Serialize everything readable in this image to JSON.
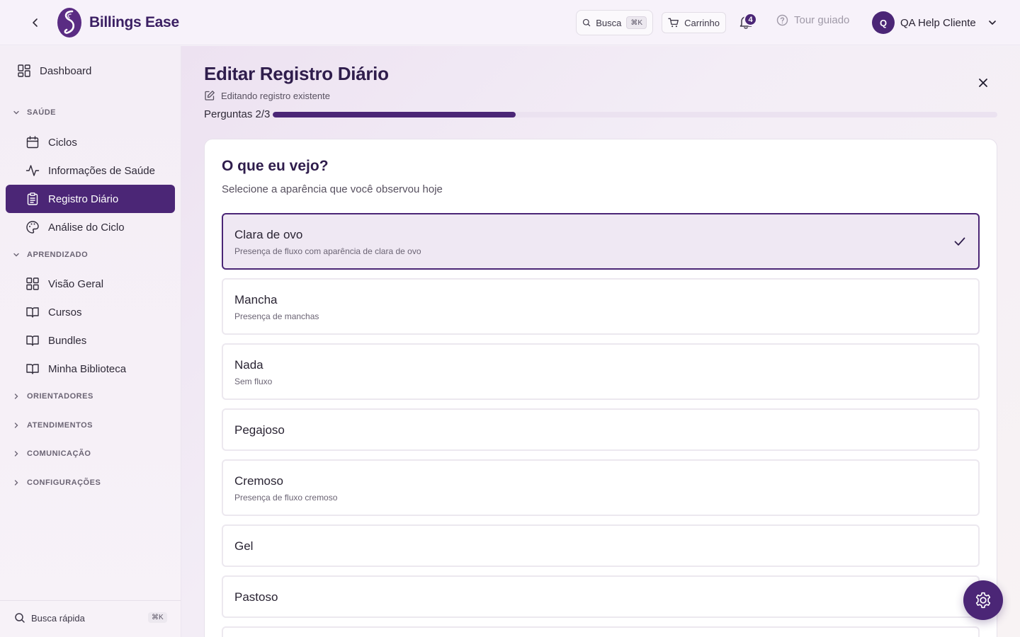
{
  "header": {
    "brand": "Billings Ease",
    "search_label": "Busca",
    "search_shortcut": "⌘K",
    "cart_label": "Carrinho",
    "notification_count": "4",
    "tour_label": "Tour guiado",
    "user_initial": "Q",
    "user_name": "QA Help Cliente"
  },
  "sidebar": {
    "dashboard": "Dashboard",
    "sections": {
      "saude": "SAÚDE",
      "aprendizado": "APRENDIZADO",
      "orientadores": "ORIENTADORES",
      "atendimentos": "ATENDIMENTOS",
      "comunicacao": "COMUNICAÇÃO",
      "configuracoes": "CONFIGURAÇÕES"
    },
    "saude_items": [
      "Ciclos",
      "Informações de Saúde",
      "Registro Diário",
      "Análise do Ciclo"
    ],
    "aprendizado_items": [
      "Visão Geral",
      "Cursos",
      "Bundles",
      "Minha Biblioteca"
    ],
    "quick_search": "Busca rápida",
    "quick_search_shortcut": "⌘K"
  },
  "main": {
    "title": "Editar Registro Diário",
    "edit_note": "Editando registro existente",
    "progress_label": "Perguntas 2/3",
    "progress_fraction": 0.3353,
    "question": {
      "title": "O que eu vejo?",
      "subtitle": "Selecione a aparência que você observou hoje",
      "options": [
        {
          "label": "Clara de ovo",
          "desc": "Presença de fluxo com aparência de clara de ovo",
          "selected": true
        },
        {
          "label": "Mancha",
          "desc": "Presença de manchas",
          "selected": false
        },
        {
          "label": "Nada",
          "desc": "Sem fluxo",
          "selected": false
        },
        {
          "label": "Pegajoso",
          "desc": "",
          "selected": false
        },
        {
          "label": "Cremoso",
          "desc": "Presença de fluxo cremoso",
          "selected": false
        },
        {
          "label": "Gel",
          "desc": "",
          "selected": false
        },
        {
          "label": "Pastoso",
          "desc": "",
          "selected": false
        }
      ]
    }
  },
  "colors": {
    "accent": "#4b2676",
    "selected_bg": "#efe8f3"
  }
}
